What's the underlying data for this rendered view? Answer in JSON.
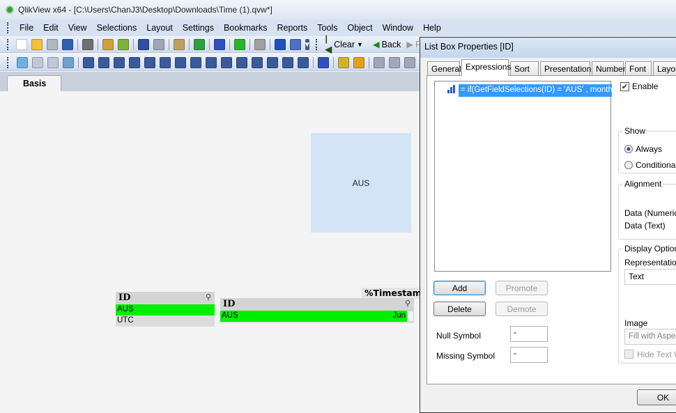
{
  "window": {
    "title": "QlikView x64 - [C:\\Users\\ChanJ3\\Desktop\\Downloads\\Time (1).qvw*]"
  },
  "menu": [
    "File",
    "Edit",
    "View",
    "Selections",
    "Layout",
    "Settings",
    "Bookmarks",
    "Reports",
    "Tools",
    "Object",
    "Window",
    "Help"
  ],
  "toolbar1": {
    "icons": [
      {
        "name": "new-icon",
        "color": "#ffffff"
      },
      {
        "name": "open-icon",
        "color": "#f0c040"
      },
      {
        "name": "reload-icon",
        "color": "#b0b8c0"
      },
      {
        "name": "save-icon",
        "color": "#3060b0"
      },
      {
        "sep": true
      },
      {
        "name": "print-icon",
        "color": "#707070"
      },
      {
        "sep": true
      },
      {
        "name": "edit-script-icon",
        "color": "#d0a040"
      },
      {
        "name": "reload-data-icon",
        "color": "#80b040"
      },
      {
        "sep": true
      },
      {
        "name": "undo-icon",
        "color": "#3050a0"
      },
      {
        "name": "redo-icon",
        "color": "#a0a8b8"
      },
      {
        "sep": true
      },
      {
        "name": "search-icon",
        "color": "#c0a060"
      },
      {
        "sep": true
      },
      {
        "name": "checkbox-icon",
        "color": "#30a040"
      },
      {
        "sep": true
      },
      {
        "name": "chart-wizard-icon",
        "color": "#3050c0"
      },
      {
        "sep": true
      },
      {
        "name": "bookmark-star-icon",
        "color": "#30b030"
      },
      {
        "sep": true
      },
      {
        "name": "properties-icon",
        "color": "#a0a0a0"
      },
      {
        "sep": true
      },
      {
        "name": "help-icon",
        "color": "#2050c0"
      },
      {
        "name": "context-help-icon",
        "color": "#5070c0"
      }
    ],
    "clear_label": "Clear",
    "back_label": "Back",
    "forward_label": "Fo"
  },
  "toolbar2": {
    "icons": [
      {
        "name": "new-sheet-icon",
        "color": "#70b0e0"
      },
      {
        "name": "sheet-left-icon",
        "color": "#c0c8d8"
      },
      {
        "name": "sheet-right-icon",
        "color": "#c0c8d8"
      },
      {
        "name": "sheet-properties-icon",
        "color": "#70a0d0"
      },
      {
        "sep": true
      },
      {
        "name": "listbox-icon",
        "color": "#3a5a9a"
      },
      {
        "name": "statistics-box-icon",
        "color": "#3a5a9a"
      },
      {
        "name": "table-box-icon",
        "color": "#3a5a9a"
      },
      {
        "name": "multibox-icon",
        "color": "#3a5a9a"
      },
      {
        "name": "chart-icon",
        "color": "#3a5a9a"
      },
      {
        "name": "input-box-icon",
        "color": "#3a5a9a"
      },
      {
        "name": "current-selections-icon",
        "color": "#3a5a9a"
      },
      {
        "name": "button-object-icon",
        "color": "#3a5a9a"
      },
      {
        "name": "text-object-icon",
        "color": "#3a5a9a"
      },
      {
        "name": "line-arrow-icon",
        "color": "#3a5a9a"
      },
      {
        "name": "slider-icon",
        "color": "#3a5a9a"
      },
      {
        "name": "bookmark-object-icon",
        "color": "#3a5a9a"
      },
      {
        "name": "search-object-icon",
        "color": "#3a5a9a"
      },
      {
        "name": "container-icon",
        "color": "#3a5a9a"
      },
      {
        "name": "custom-object-icon",
        "color": "#3a5a9a"
      },
      {
        "sep": true
      },
      {
        "name": "chart-wizard2-icon",
        "color": "#3050c0"
      },
      {
        "sep": true
      },
      {
        "name": "format-painter-icon",
        "color": "#d0b030"
      },
      {
        "name": "layout-icon",
        "color": "#e0a020"
      },
      {
        "sep": true
      },
      {
        "name": "align-left-icon",
        "color": "#a0a8b8"
      },
      {
        "name": "align-center-icon",
        "color": "#a0a8b8"
      },
      {
        "name": "align-right-icon",
        "color": "#a0a8b8"
      }
    ]
  },
  "sheet": {
    "tab": "Basis",
    "text_object": "AUS",
    "listbox1": {
      "title": "ID",
      "rows": [
        {
          "value": "AUS",
          "selected": true
        },
        {
          "value": "UTC",
          "selected": false
        }
      ]
    },
    "listbox2": {
      "title": "ID",
      "rows": [
        {
          "value": "AUS",
          "expr": "Jun",
          "selected": true
        }
      ]
    },
    "timestamp_caption": "%Timestamp"
  },
  "dialog": {
    "title": "List Box Properties [ID]",
    "tabs": [
      "General",
      "Expressions",
      "Sort",
      "Presentation",
      "Number",
      "Font",
      "Layout"
    ],
    "active_tab": "Expressions",
    "expression": "= if(GetFieldSelections(ID) = 'AUS' , month(%Timestamp)",
    "enable_label": "Enable",
    "enable_checked": true,
    "show": {
      "title": "Show",
      "options": [
        "Always",
        "Conditional"
      ],
      "selected": "Always"
    },
    "alignment": {
      "title": "Alignment",
      "rows": [
        "Data (Numeric)",
        "Data (Text)"
      ]
    },
    "display_options": {
      "title": "Display Options",
      "representation_label": "Representation",
      "representation_value": "Text",
      "image_formatting_label": "Image Formatting",
      "image_formatting_value": "Fill with Aspect",
      "hide_text_label": "Hide Text W"
    },
    "buttons": {
      "add": "Add",
      "promote": "Promote",
      "delete": "Delete",
      "demote": "Demote",
      "ok": "OK"
    },
    "null_symbol": {
      "label": "Null Symbol",
      "value": "-"
    },
    "missing_symbol": {
      "label": "Missing Symbol",
      "value": "-"
    }
  }
}
